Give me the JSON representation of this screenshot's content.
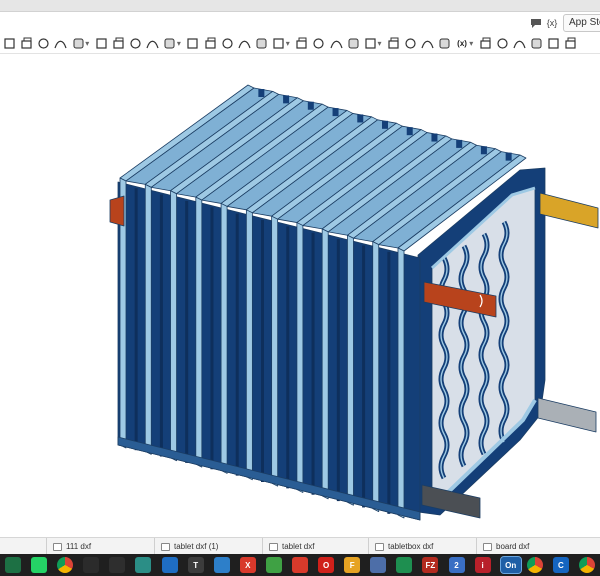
{
  "header": {
    "comment_icon": "comment-icon",
    "variable_icon": "variable-icon",
    "variable_label": "{x}",
    "app_store_label": "App Store"
  },
  "toolbar": {
    "variable_label": "(x)",
    "tools": [
      "sketch-tool",
      "extrude-tool",
      "revolve-tool",
      "sweep-tool",
      "loft-tool",
      "thicken-tool",
      "enclose-tool",
      "fillet-tool",
      "chamfer-tool",
      "draft-tool",
      "shell-tool",
      "hole-tool",
      "linear-pattern-tool",
      "mirror-tool",
      "boolean-tool",
      "split-tool",
      "transform-tool",
      "delete-part-tool",
      "modify-fillet-tool",
      "move-face-tool",
      "replace-face-tool",
      "offset-surface-tool",
      "plane-tool",
      "mate-connector-tool",
      "helix-tool",
      "variable-tool",
      "measure-tool",
      "section-view-tool",
      "wrap-tool",
      "bend-tool",
      "custom-feature-tool",
      "add-feature-tool"
    ]
  },
  "viewport": {
    "model": "finned-enclosure-3d-model",
    "colors": {
      "body": "#143f78",
      "fin_top": "#9ec9e4",
      "edge": "#1b3d63",
      "orange_tab": "#b8431c",
      "yellow_tab": "#d9a428",
      "gray_tab": "#aab0b6",
      "dark_tab": "#4b4f54"
    }
  },
  "tabs": [
    {
      "label": "111 dxf"
    },
    {
      "label": "tablet dxf (1)"
    },
    {
      "label": "tablet dxf"
    },
    {
      "label": "tabletbox dxf"
    },
    {
      "label": "board dxf"
    }
  ],
  "taskbar": {
    "apps": [
      {
        "icon": "excel-icon",
        "color": "#1d7044",
        "label": ""
      },
      {
        "icon": "whatsapp-icon",
        "color": "#25d366",
        "label": ""
      },
      {
        "icon": "chrome-icon",
        "color": "#3a3a3a",
        "label": ""
      },
      {
        "icon": "audio-icon",
        "color": "#2b2b2b",
        "label": ""
      },
      {
        "icon": "arrow-app-icon",
        "color": "#2e2e2e",
        "label": ""
      },
      {
        "icon": "media-icon",
        "color": "#2b8e86",
        "label": ""
      },
      {
        "icon": "edge-icon",
        "color": "#1f6dc2",
        "label": ""
      },
      {
        "icon": "text-app-icon",
        "color": "#3c3c3c",
        "label": "T"
      },
      {
        "icon": "photo-app-icon",
        "color": "#2d7fc9",
        "label": ""
      },
      {
        "icon": "red-app-icon",
        "color": "#d8392b",
        "label": "X"
      },
      {
        "icon": "green-leaf-icon",
        "color": "#3fa144",
        "label": ""
      },
      {
        "icon": "sketchup-icon",
        "color": "#d93a2b",
        "label": ""
      },
      {
        "icon": "opera-icon",
        "color": "#d0201a",
        "label": "O"
      },
      {
        "icon": "f-app-icon",
        "color": "#e6a323",
        "label": "F"
      },
      {
        "icon": "image-app-icon",
        "color": "#4d6ea8",
        "label": ""
      },
      {
        "icon": "sheets-icon",
        "color": "#1e8f50",
        "label": ""
      },
      {
        "icon": "filezilla-icon",
        "color": "#b32a1f",
        "label": "FZ"
      },
      {
        "icon": "two-app-icon",
        "color": "#3a6fc4",
        "label": "2"
      },
      {
        "icon": "info-app-icon",
        "color": "#b8202a",
        "label": "i"
      },
      {
        "icon": "onshape-icon",
        "color": "#1f5fa6",
        "label": "On"
      },
      {
        "icon": "drive-icon",
        "color": "#2b2b2b",
        "label": ""
      },
      {
        "icon": "c-app-icon",
        "color": "#1565c0",
        "label": "C"
      },
      {
        "icon": "chrome-icon-2",
        "color": "#2b2b2b",
        "label": ""
      }
    ]
  }
}
